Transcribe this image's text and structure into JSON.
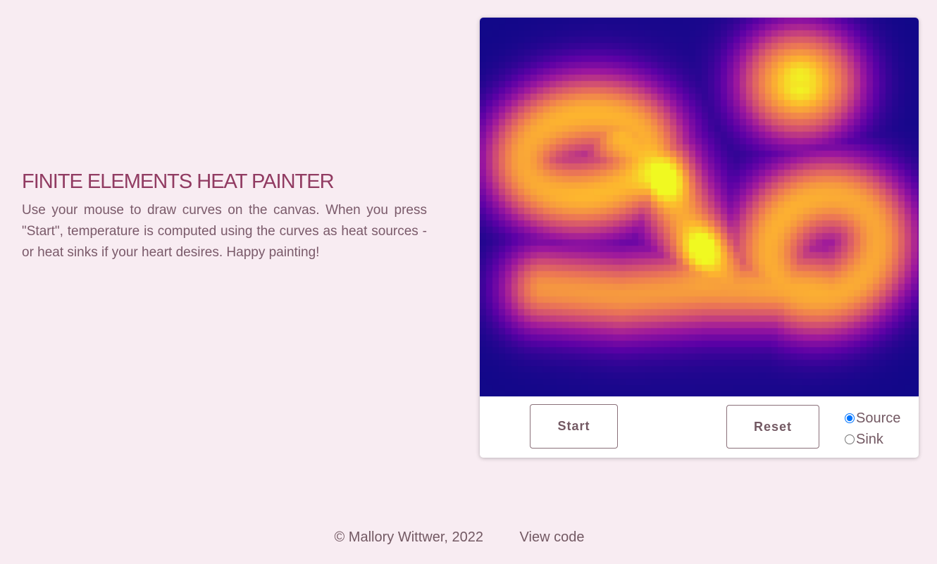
{
  "header": {
    "title": "FINITE ELEMENTS HEAT PAINTER",
    "description": "Use your mouse to draw curves on the canvas. When you press \"Start\", temperature is computed using the curves as heat sources - or heat sinks if your heart desires. Happy painting!"
  },
  "canvas": {
    "colormap": [
      "#0d0887",
      "#5c01a6",
      "#9c179e",
      "#cc4778",
      "#ed7953",
      "#fdb42f",
      "#f0f921"
    ]
  },
  "controls": {
    "start_label": "Start",
    "reset_label": "Reset",
    "mode_options": [
      "Source",
      "Sink"
    ],
    "selected_mode": "Source"
  },
  "footer": {
    "copyright": "© Mallory Wittwer, 2022",
    "view_code": "View code"
  }
}
